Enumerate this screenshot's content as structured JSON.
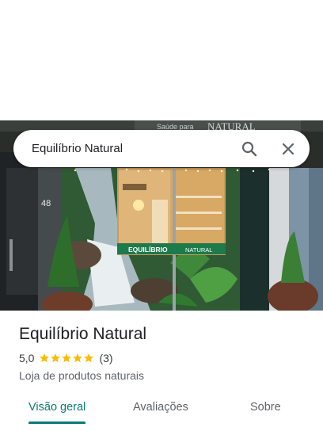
{
  "search": {
    "query": "Equilíbrio Natural",
    "search_icon": "search-icon",
    "close_icon": "close-icon"
  },
  "hero_photo": {
    "signage": {
      "store_name": "EQUILÍBRIO",
      "store_name_right": "NATURAL",
      "top_sign": "NATURAL",
      "top_sign_small": "Saúde para",
      "street_number": "48"
    }
  },
  "place": {
    "name": "Equilíbrio Natural",
    "rating": "5,0",
    "stars": 5,
    "review_count": "(3)",
    "category": "Loja de produtos naturais"
  },
  "tabs": [
    {
      "label": "Visão geral",
      "active": true
    },
    {
      "label": "Avaliações",
      "active": false
    },
    {
      "label": "Sobre",
      "active": false
    }
  ],
  "colors": {
    "accent": "#0b7a75",
    "star": "#fbbc04",
    "sign_green": "#1d7a4a"
  }
}
